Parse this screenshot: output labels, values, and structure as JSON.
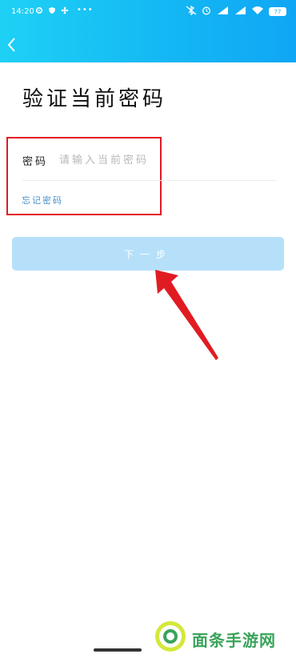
{
  "status_bar": {
    "time": "14:20",
    "dots": "•••",
    "battery": "77"
  },
  "header": {
    "back_icon": "chevron-left-icon"
  },
  "page": {
    "title": "验证当前密码"
  },
  "form": {
    "password_label": "密码",
    "password_placeholder": "请输入当前密码",
    "password_value": "",
    "forgot_link": "忘记密码"
  },
  "actions": {
    "next_label": "下一步"
  },
  "annotation": {
    "box_color": "#e11b22",
    "arrow_color": "#e11b22"
  },
  "watermark": {
    "text": "面条手游网"
  },
  "colors": {
    "header_start": "#1fd1f5",
    "header_end": "#0fa6f5",
    "button_bg": "#b6e0fa",
    "link": "#4a90c8"
  }
}
